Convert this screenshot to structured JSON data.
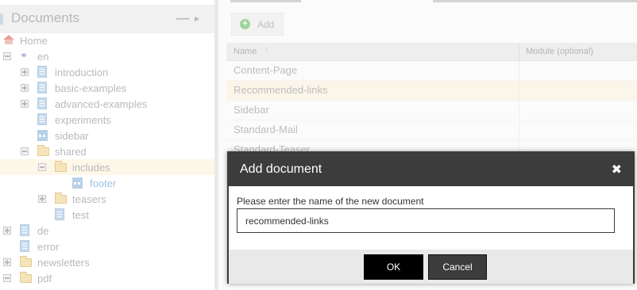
{
  "left_panel": {
    "title": "Documents",
    "collapse_symbol": "—",
    "arrow_symbol": "▸",
    "tree": [
      {
        "id": "home",
        "label": "Home",
        "icon": "home-icon",
        "toggle": null
      },
      {
        "id": "en",
        "label": "en",
        "icon": "link-icon",
        "toggle": "minus"
      },
      {
        "id": "introduction",
        "label": "introduction",
        "icon": "document-icon",
        "toggle": "plus"
      },
      {
        "id": "basic-examples",
        "label": "basic-examples",
        "icon": "document-icon",
        "toggle": "plus"
      },
      {
        "id": "advanced-examples",
        "label": "advanced-examples",
        "icon": "document-icon",
        "toggle": "plus"
      },
      {
        "id": "experiments",
        "label": "experiments",
        "icon": "document-icon",
        "toggle": null
      },
      {
        "id": "sidebar",
        "label": "sidebar",
        "icon": "component-icon",
        "toggle": null
      },
      {
        "id": "shared",
        "label": "shared",
        "icon": "folder-icon",
        "toggle": "minus"
      },
      {
        "id": "includes",
        "label": "includes",
        "icon": "folder-icon",
        "toggle": "minus",
        "selected": true
      },
      {
        "id": "footer",
        "label": "footer",
        "icon": "component-icon",
        "toggle": null
      },
      {
        "id": "teasers",
        "label": "teasers",
        "icon": "folder-icon",
        "toggle": "plus"
      },
      {
        "id": "test",
        "label": "test",
        "icon": "document-icon",
        "toggle": null
      },
      {
        "id": "de",
        "label": "de",
        "icon": "document-icon",
        "toggle": "plus"
      },
      {
        "id": "error",
        "label": "error",
        "icon": "document-icon",
        "toggle": null
      },
      {
        "id": "newsletters",
        "label": "newsletters",
        "icon": "folder-icon",
        "toggle": "plus"
      },
      {
        "id": "pdf",
        "label": "pdf",
        "icon": "folder-icon",
        "toggle": "minus"
      }
    ]
  },
  "toolbar": {
    "add_label": "Add",
    "add_icon_glyph": "+"
  },
  "grid": {
    "columns": [
      "Name",
      "Module (optional)"
    ],
    "sort_glyph": "↑",
    "rows": [
      {
        "name": "Content-Page",
        "module": ""
      },
      {
        "name": "Recommended-links",
        "module": "",
        "highlighted": true
      },
      {
        "name": "Sidebar",
        "module": ""
      },
      {
        "name": "Standard-Mail",
        "module": ""
      },
      {
        "name": "Standard-Teaser",
        "module": ""
      }
    ]
  },
  "dialog": {
    "title": "Add document",
    "close_glyph": "✖",
    "prompt": "Please enter the name of the new document",
    "input_value": "recommended-links",
    "ok_label": "OK",
    "cancel_label": "Cancel"
  }
}
